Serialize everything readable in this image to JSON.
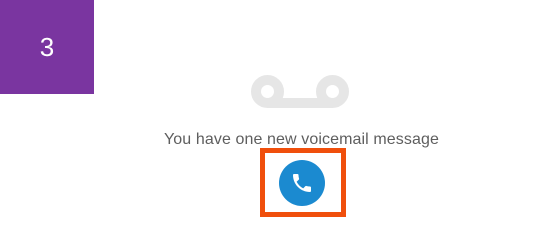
{
  "step": {
    "number": "3",
    "badge_color": "#7a35a0"
  },
  "voicemail": {
    "icon": "voicemail-icon",
    "icon_color": "#e6e6e6",
    "message": "You have one new voicemail message"
  },
  "call": {
    "icon": "phone-icon",
    "button_color": "#1b8ad0",
    "highlight_color": "#f04f0c"
  }
}
